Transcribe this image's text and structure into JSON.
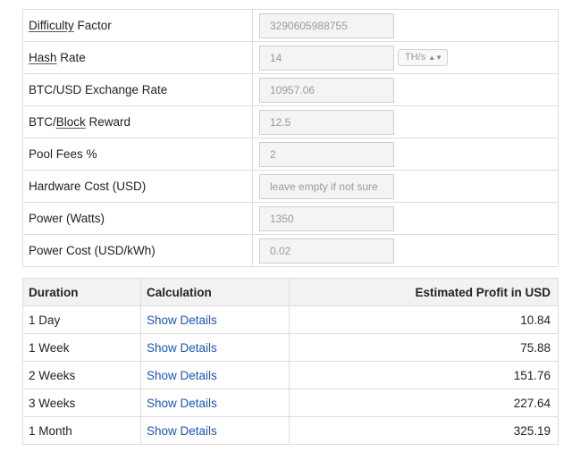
{
  "inputs": [
    {
      "label": "Difficulty Factor",
      "value": "3290605988755",
      "underline": "Difficulty"
    },
    {
      "label": "Hash Rate",
      "value": "14",
      "unit": "TH/s",
      "underline": "Hash"
    },
    {
      "label": "BTC/USD Exchange Rate",
      "value": "10957.06"
    },
    {
      "label": "BTC/Block Reward",
      "value": "12.5",
      "underline": "Block"
    },
    {
      "label": "Pool Fees %",
      "value": "2"
    },
    {
      "label": "Hardware Cost (USD)",
      "value": "",
      "placeholder": "leave empty if not sure"
    },
    {
      "label": "Power (Watts)",
      "value": "1350"
    },
    {
      "label": "Power Cost (USD/kWh)",
      "value": "0.02"
    }
  ],
  "results": {
    "headers": {
      "duration": "Duration",
      "calculation": "Calculation",
      "profit": "Estimated Profit in USD"
    },
    "rows": [
      {
        "duration": "1 Day",
        "calculation": "Show Details",
        "profit": "10.84"
      },
      {
        "duration": "1 Week",
        "calculation": "Show Details",
        "profit": "75.88"
      },
      {
        "duration": "2 Weeks",
        "calculation": "Show Details",
        "profit": "151.76"
      },
      {
        "duration": "3 Weeks",
        "calculation": "Show Details",
        "profit": "227.64"
      },
      {
        "duration": "1 Month",
        "calculation": "Show Details",
        "profit": "325.19"
      }
    ]
  },
  "colors": {
    "link": "#1a56b8",
    "border": "#dddddd",
    "header_bg": "#f2f2f2"
  }
}
